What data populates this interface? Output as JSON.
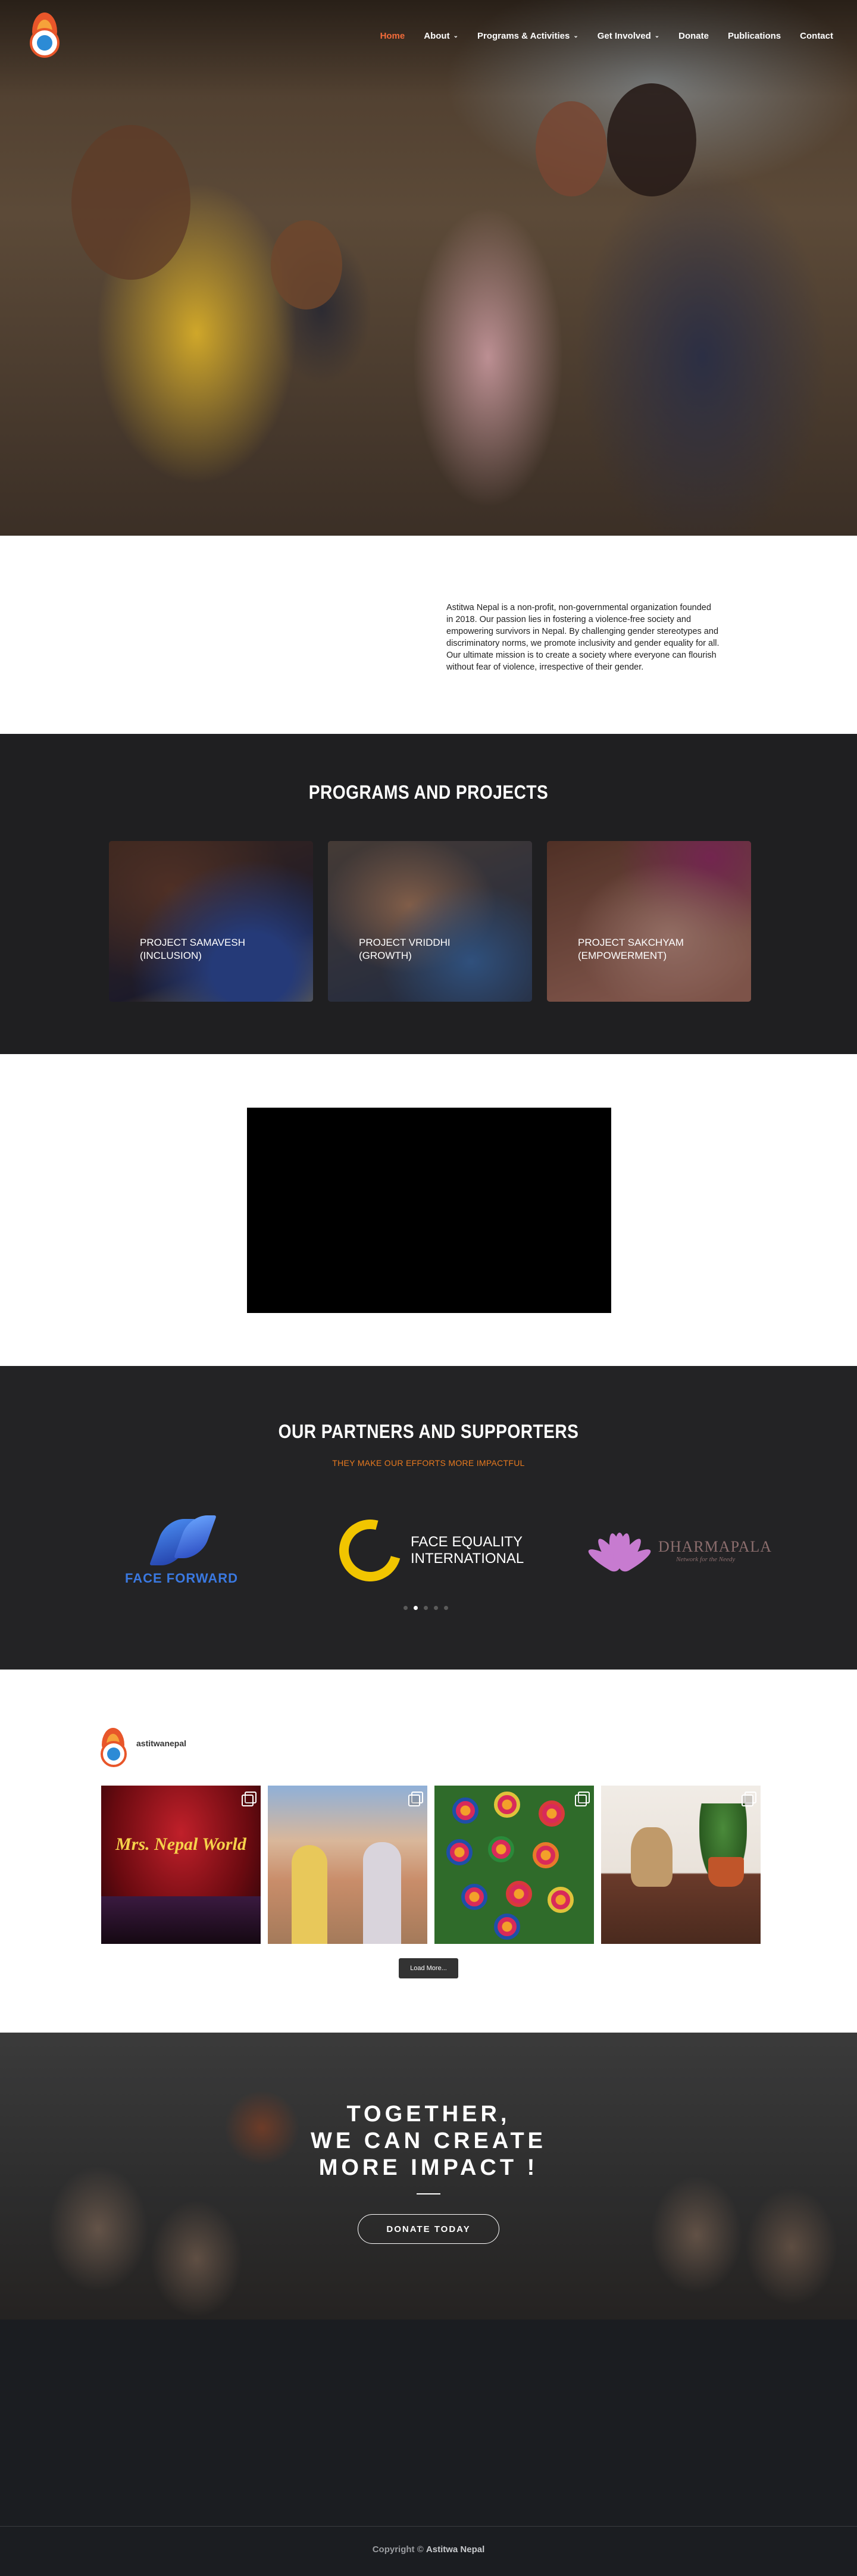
{
  "nav": {
    "items": [
      {
        "label": "Home",
        "active": true,
        "has_dropdown": false
      },
      {
        "label": "About",
        "active": false,
        "has_dropdown": true
      },
      {
        "label": "Programs & Activities",
        "active": false,
        "has_dropdown": true
      },
      {
        "label": "Get Involved",
        "active": false,
        "has_dropdown": true
      },
      {
        "label": "Donate",
        "active": false,
        "has_dropdown": false
      },
      {
        "label": "Publications",
        "active": false,
        "has_dropdown": false
      },
      {
        "label": "Contact",
        "active": false,
        "has_dropdown": false
      }
    ],
    "dropdown_glyph": "⌄"
  },
  "about": {
    "text": "Astitwa Nepal is a non-profit, non-governmental organization founded in 2018. Our passion lies in fostering a violence-free society and empowering survivors in Nepal. By challenging gender stereotypes and discriminatory norms, we promote inclusivity and gender equality for all. Our ultimate mission is to create a society where everyone can flourish without fear of violence, irrespective of their gender."
  },
  "programs": {
    "title": "PROGRAMS AND PROJECTS",
    "cards": [
      {
        "line1": "PROJECT SAMAVESH",
        "line2": "(INCLUSION)"
      },
      {
        "line1": "PROJECT VRIDDHI",
        "line2": "(GROWTH)"
      },
      {
        "line1": "PROJECT SAKCHYAM",
        "line2": "(EMPOWERMENT)"
      }
    ]
  },
  "partners": {
    "title": "OUR PARTNERS AND SUPPORTERS",
    "subtitle": "THEY MAKE OUR EFFORTS MORE IMPACTFUL",
    "logos": {
      "face_forward": "FACE FORWARD",
      "face_equality_line1": "FACE EQUALITY",
      "face_equality_line2": "INTERNATIONAL",
      "dharmapala_name": "DHARMAPALA",
      "dharmapala_tagline": "Network for the Needy"
    },
    "slider_count": 5,
    "slider_active": 1
  },
  "instagram": {
    "handle": "astitwanepal",
    "post1_text": "Mrs. Nepal World",
    "load_more": "Load More..."
  },
  "cta": {
    "line1": "TOGETHER,",
    "line2": "WE CAN CREATE",
    "line3": "MORE IMPACT !",
    "button": "DONATE TODAY"
  },
  "footer": {
    "prefix": "Copyright ©",
    "org": "Astitwa Nepal"
  },
  "colors": {
    "accent": "#f26b3a",
    "partner_subtitle": "#e87a1f",
    "dark_section": "#1f1f21"
  }
}
